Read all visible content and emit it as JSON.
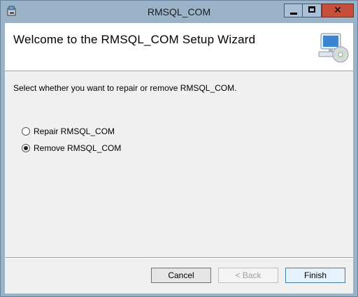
{
  "window": {
    "title": "RMSQL_COM",
    "icons": {
      "app": "installer-icon",
      "minimize": "minimize-icon",
      "maximize": "maximize-icon",
      "close": "close-icon"
    },
    "close_glyph": "✕"
  },
  "banner": {
    "title": "Welcome to the RMSQL_COM Setup Wizard",
    "icon": "computer-cd-icon"
  },
  "body": {
    "instruction": "Select whether you want to repair or remove RMSQL_COM.",
    "options": [
      {
        "label": "Repair RMSQL_COM",
        "checked": false
      },
      {
        "label": "Remove RMSQL_COM",
        "checked": true
      }
    ]
  },
  "buttons": {
    "cancel": "Cancel",
    "back": "< Back",
    "finish": "Finish"
  },
  "colors": {
    "frame": "#9bb3c9",
    "close": "#c7503d",
    "dialog": "#f0f0f0",
    "banner": "#ffffff"
  }
}
